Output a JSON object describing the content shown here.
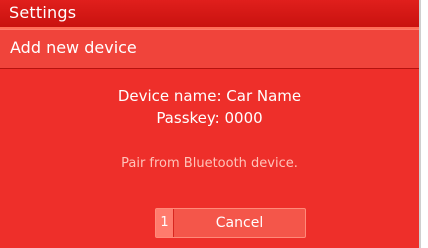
{
  "header": {
    "title": "Settings"
  },
  "subheader": {
    "title": "Add new device"
  },
  "dialog": {
    "device_name_line": "Device name: Car Name",
    "passkey_line": "Passkey: 0000",
    "message": "Pair from Bluetooth device.",
    "cancel": {
      "key": "1",
      "label": "Cancel"
    }
  },
  "colors": {
    "background": "#ee2f2a",
    "header": "#d4171a",
    "subheader": "#f0443b",
    "message_text": "#ffc3b9",
    "button": "#f4564a"
  }
}
